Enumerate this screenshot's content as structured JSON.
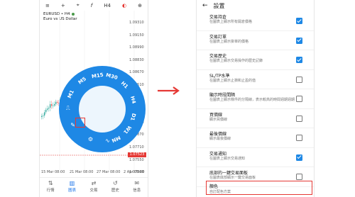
{
  "left": {
    "toolbar": {
      "add_icon": "+",
      "crosshair_icon": "⌖",
      "indicator_icon": "f",
      "timeframe": "H4",
      "objects_icon": "◐",
      "trade_icon": "⊕"
    },
    "symbol": {
      "name": "EURUSD • H4",
      "desc": "Euro vs US Dollar"
    },
    "prices": [
      "1.09310",
      "1.09150",
      "1.08990",
      "1.08830",
      "1.08670",
      "1.08510",
      "1.08350",
      "1.08190",
      "1.08030",
      "1.07870",
      "1.07710",
      "1.07550",
      "1.07360"
    ],
    "current_price": "1.07523",
    "dates": [
      "15 Mar 08:00",
      "21 Mar 08:00",
      "27 Mar 08:00",
      "2 Apr 08:00"
    ],
    "wheel_labels": [
      "M1",
      "M5",
      "M15",
      "M30",
      "H1",
      "H4",
      "D1",
      "W1",
      "MN"
    ],
    "tabs": [
      {
        "label": "行情",
        "icon": "⇅",
        "active": false
      },
      {
        "label": "圖表",
        "icon": "▥",
        "active": true
      },
      {
        "label": "交易",
        "icon": "⇄",
        "active": false
      },
      {
        "label": "歷史",
        "icon": "↺",
        "active": false
      },
      {
        "label": "信息",
        "icon": "✉",
        "active": false
      }
    ]
  },
  "right": {
    "header": {
      "title": "設置"
    },
    "rows": [
      {
        "title": "交易持倉",
        "desc": "在圖表上顯示所有開倉價格",
        "checked": true
      },
      {
        "title": "交易訂單",
        "desc": "在圖表上顯示掛單的價格",
        "checked": true
      },
      {
        "title": "交易歷史",
        "desc": "在圖表上顯示交易操作的歷史記錄",
        "checked": true
      },
      {
        "title": "SL/TP水準",
        "desc": "在圖表上顯示止損和止盈的值",
        "checked": false
      },
      {
        "title": "顯示時段間隔",
        "desc": "在圖表上顯示條件的分隔線，表示較高的時間週期週期",
        "checked": false
      },
      {
        "title": "買價線",
        "desc": "顯示買價線",
        "checked": false
      },
      {
        "title": "最後價線",
        "desc": "顯示最後價線",
        "checked": false
      },
      {
        "title": "交易通知",
        "desc": "在圖表上顯示交易通知",
        "checked": true
      },
      {
        "title": "底部的一鍵交易面板",
        "desc": "在圖表底部顯示一鍵交易面板",
        "checked": false
      }
    ],
    "color_row": {
      "title": "顏色",
      "desc": "自訂配色方案"
    }
  },
  "colors": {
    "accent": "#1e88e5",
    "highlight": "#e53935",
    "bull": "#26a69a",
    "bear": "#ef5350"
  }
}
